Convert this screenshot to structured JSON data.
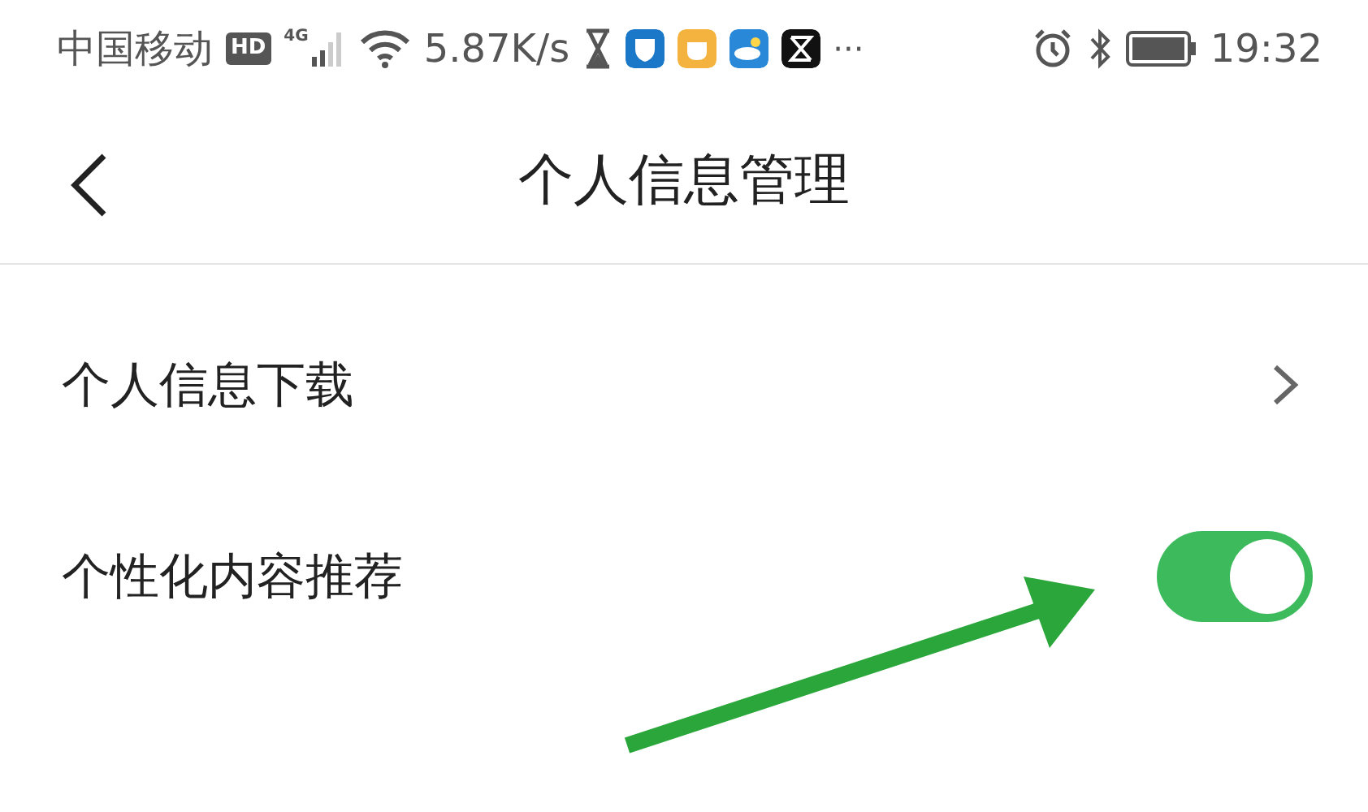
{
  "status_bar": {
    "carrier": "中国移动",
    "hd_badge": "HD",
    "network_type": "4G",
    "speed": "5.87K/s",
    "more": "···",
    "time": "19:32"
  },
  "header": {
    "title": "个人信息管理"
  },
  "items": [
    {
      "kind": "link",
      "label": "个人信息下载"
    },
    {
      "kind": "toggle",
      "label": "个性化内容推荐",
      "on": true
    }
  ]
}
